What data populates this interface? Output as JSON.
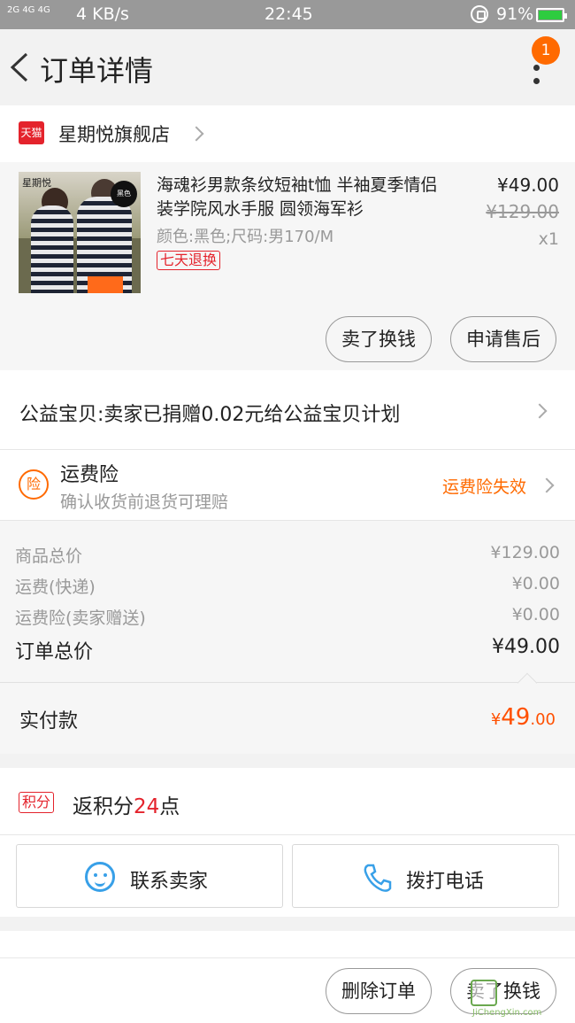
{
  "status_bar": {
    "signal_1": "2G",
    "signal_2": "4G 4G",
    "speed": "4 KB/s",
    "time": "22:45",
    "battery": "91%"
  },
  "header": {
    "title": "订单详情",
    "badge_count": "1"
  },
  "shop": {
    "logo_text": "天猫",
    "name": "星期悦旗舰店"
  },
  "product": {
    "title": "海魂衫男款条纹短袖t恤 半袖夏季情侣装学院风水手服 圆领海军衫",
    "spec": "颜色:黑色;尺码:男170/M",
    "return_tag": "七天退换",
    "price": "¥49.00",
    "old_price": "¥129.00",
    "qty": "x1",
    "image_brand": "星期悦",
    "image_tag": "黑色",
    "sell_button": "卖了换钱",
    "after_sale_button": "申请售后"
  },
  "charity": {
    "text": "公益宝贝:卖家已捐赠0.02元给公益宝贝计划"
  },
  "insurance": {
    "icon_text": "险",
    "title": "运费险",
    "subtitle": "确认收货前退货可理赔",
    "status": "运费险失效"
  },
  "summary": {
    "rows": [
      {
        "label": "商品总价",
        "value": "¥129.00"
      },
      {
        "label": "运费(快递)",
        "value": "¥0.00"
      },
      {
        "label": "运费险(卖家赠送)",
        "value": "¥0.00"
      }
    ],
    "total_label": "订单总价",
    "total_value": "¥49.00"
  },
  "paid": {
    "label": "实付款",
    "symbol": "¥",
    "integer": "49",
    "decimal": ".00"
  },
  "points": {
    "tag": "积分",
    "prefix": "返积分",
    "number": "24",
    "suffix": "点"
  },
  "contact": {
    "seller": "联系卖家",
    "phone": "拨打电话"
  },
  "bottom": {
    "delete_button": "删除订单",
    "sell_button": "卖了换钱"
  },
  "watermark": {
    "site": "JiChengXin.com"
  },
  "colors": {
    "accent_orange": "#ff6a00",
    "tmall_red": "#e4232c",
    "chat_blue": "#38a0e8"
  }
}
